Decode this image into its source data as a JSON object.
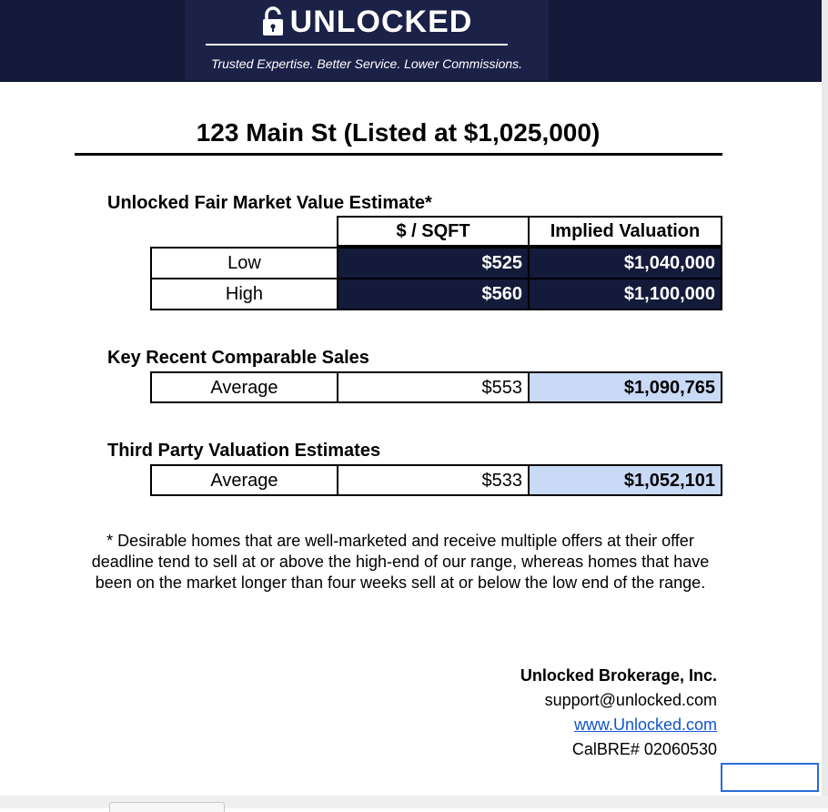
{
  "header": {
    "brand": "UNLOCKED",
    "tagline": "Trusted Expertise. Better Service. Lower Commissions."
  },
  "title": "123 Main St (Listed at $1,025,000)",
  "fair_market": {
    "heading": "Unlocked Fair Market Value Estimate*",
    "col_headers": [
      "$ / SQFT",
      "Implied Valuation"
    ],
    "rows": [
      {
        "label": "Low",
        "per_sqft": "$525",
        "valuation": "$1,040,000"
      },
      {
        "label": "High",
        "per_sqft": "$560",
        "valuation": "$1,100,000"
      }
    ]
  },
  "comparable_sales": {
    "heading": "Key Recent Comparable Sales",
    "label": "Average",
    "per_sqft": "$553",
    "valuation": "$1,090,765"
  },
  "third_party": {
    "heading": "Third Party Valuation Estimates",
    "label": "Average",
    "per_sqft": "$533",
    "valuation": "$1,052,101"
  },
  "footnote": "* Desirable homes that are well-marketed and receive multiple offers at their offer deadline tend to sell at or above the high-end of our range, whereas homes that have been on the market longer than four weeks sell at or below the low end of the range.",
  "contact": {
    "company": "Unlocked Brokerage, Inc.",
    "email": "support@unlocked.com",
    "website": "www.Unlocked.com",
    "license": "CalBRE# 02060530"
  },
  "colors": {
    "navy": "#141a3a",
    "light_blue": "#c9daf6",
    "link": "#1155cc"
  }
}
